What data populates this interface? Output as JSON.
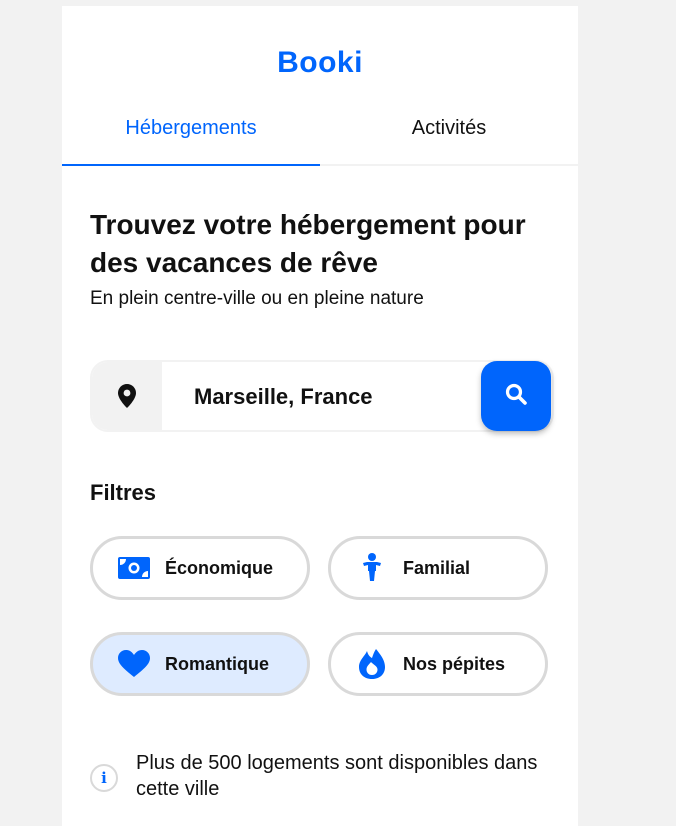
{
  "app": {
    "logo": "Booki"
  },
  "tabs": [
    {
      "label": "Hébergements",
      "active": true
    },
    {
      "label": "Activités",
      "active": false
    }
  ],
  "hero": {
    "title": "Trouvez votre hébergement pour des vacances de rêve",
    "subtitle": "En plein centre-ville ou en pleine nature"
  },
  "search": {
    "value": "Marseille, France",
    "location_icon": "map-pin-icon",
    "button_icon": "search-icon"
  },
  "filters": {
    "title": "Filtres",
    "items": [
      {
        "label": "Économique",
        "icon": "money-bill-icon",
        "selected": false
      },
      {
        "label": "Familial",
        "icon": "child-icon",
        "selected": false
      },
      {
        "label": "Romantique",
        "icon": "heart-icon",
        "selected": true
      },
      {
        "label": "Nos pépites",
        "icon": "fire-icon",
        "selected": false
      }
    ]
  },
  "info": {
    "text": "Plus de 500 logements sont disponibles dans cette ville",
    "icon": "info-icon"
  },
  "colors": {
    "primary": "#0065fc",
    "selected_chip_bg": "#deebff",
    "border": "#d9d9d9"
  }
}
